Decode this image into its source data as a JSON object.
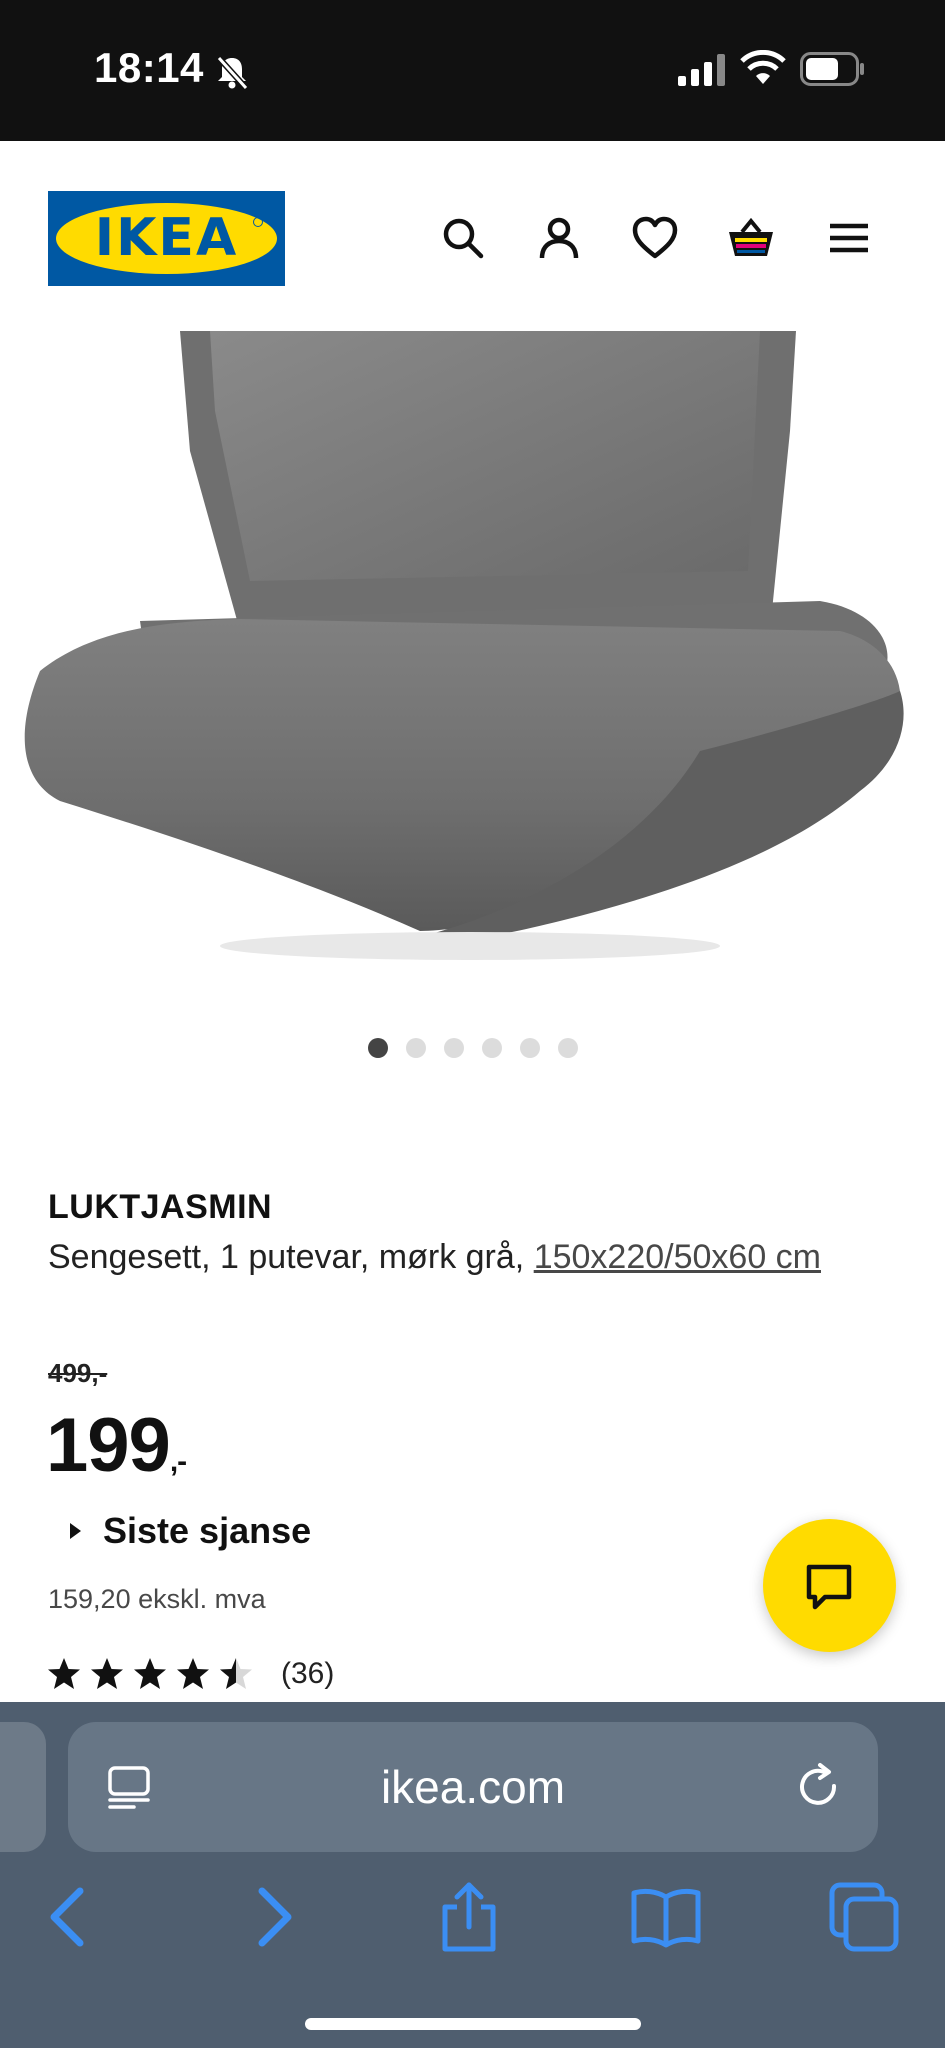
{
  "status_bar": {
    "time": "18:14",
    "icons": [
      "bell-slash-icon",
      "cellular-signal-icon",
      "wifi-icon",
      "battery-icon"
    ]
  },
  "header": {
    "logo_text": "IKEA",
    "icons": [
      "search-icon",
      "account-icon",
      "wishlist-heart-icon",
      "shopping-basket-icon",
      "menu-icon"
    ]
  },
  "carousel": {
    "total_images": 6,
    "active_index": 0
  },
  "product": {
    "name": "LUKTJASMIN",
    "description": "Sengesett, 1 putevar, mørk grå, ",
    "size_link": "150x220/50x60 cm",
    "old_price": "499,-",
    "price_main": "199",
    "price_suffix": ",-",
    "badge": "Siste sjanse",
    "price_excl_vat": "159,20 ekskl. mva",
    "rating_value": 4.5,
    "rating_count": "(36)"
  },
  "colors": {
    "ikea_blue": "#0058a3",
    "ikea_yellow": "#ffdb00",
    "safari_bar": "#4f5e6f",
    "safari_accent": "#3b8ef3"
  },
  "browser": {
    "url": "ikea.com",
    "toolbar": [
      "back-icon",
      "forward-icon",
      "share-icon",
      "bookmarks-icon",
      "tabs-icon"
    ]
  }
}
